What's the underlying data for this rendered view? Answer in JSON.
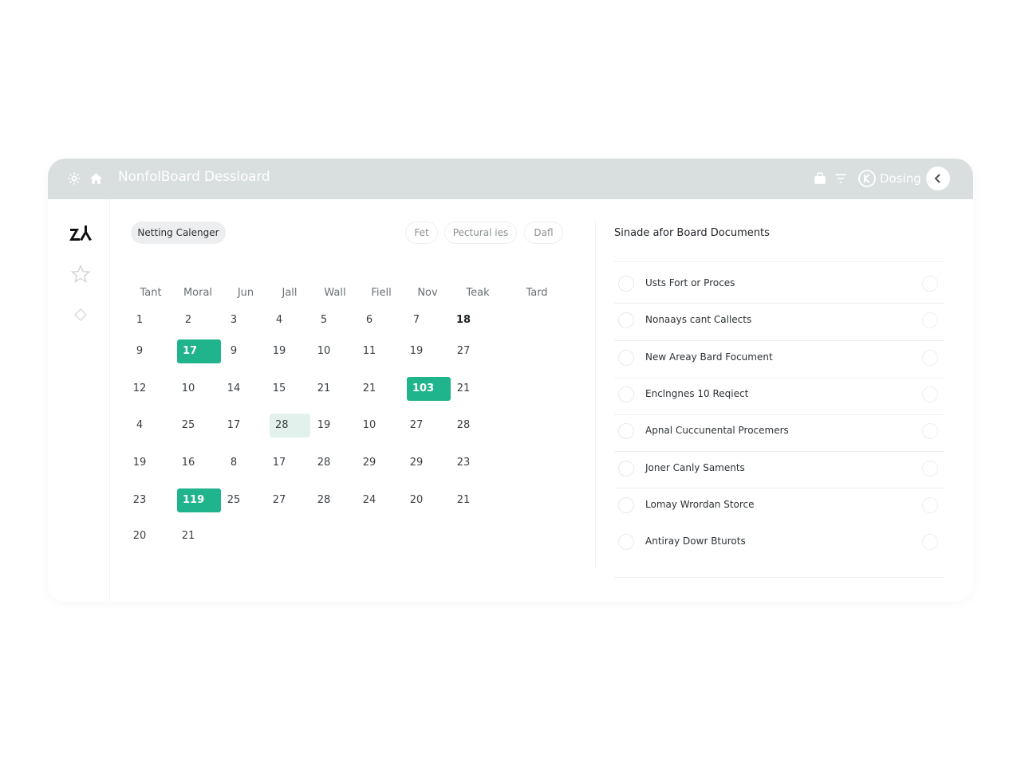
{
  "titlebar": {
    "title": "NonfolBoard Dessloard",
    "user_label": "Dosing",
    "icons": [
      "gear-icon",
      "home-icon",
      "briefcase-icon",
      "filter-icon",
      "profile-icon",
      "chevron-left-icon"
    ]
  },
  "sidebar": {
    "items": [
      {
        "icon": "logo-icon"
      },
      {
        "icon": "star-icon"
      },
      {
        "icon": "diamond-icon"
      }
    ]
  },
  "calendar": {
    "view_label": "Netting Calenger",
    "filters": [
      "Fet",
      "Pectural ies",
      "Dafl"
    ],
    "headers": [
      "Tant",
      "Moral",
      "Jun",
      "Jall",
      "Wall",
      "Fiell",
      "Nov",
      "Teak",
      "Tard"
    ],
    "rows": [
      [
        "1",
        "2",
        "3",
        "4",
        "5",
        "6",
        "7",
        "18"
      ],
      [
        "9",
        "17",
        "9",
        "19",
        "10",
        "11",
        "19",
        "27"
      ],
      [
        "12",
        "10",
        "14",
        "15",
        "21",
        "21",
        "103",
        "21"
      ],
      [
        "4",
        "25",
        "17",
        "28",
        "19",
        "10",
        "27",
        "28"
      ],
      [
        "19",
        "16",
        "8",
        "17",
        "28",
        "29",
        "29",
        "23"
      ],
      [
        "23",
        "119",
        "25",
        "27",
        "28",
        "24",
        "20",
        "21"
      ],
      [
        "20",
        "21"
      ]
    ]
  },
  "documents": {
    "title": "Sinade afor Board Documents",
    "items": [
      "Usts Fort or Proces",
      "Nonaays cant Callects",
      "New Areay Bard Focument",
      "Enclngnes 10 Reqiect",
      "Apnal Cuccunental Procemers",
      "Joner Canly Saments",
      "Lomay Wrordan Storce",
      "Antiray Dowr Bturots"
    ]
  },
  "colors": {
    "accent": "#20b48c",
    "accent_soft": "#e2f1ec",
    "titlebar": "#d9dede"
  }
}
